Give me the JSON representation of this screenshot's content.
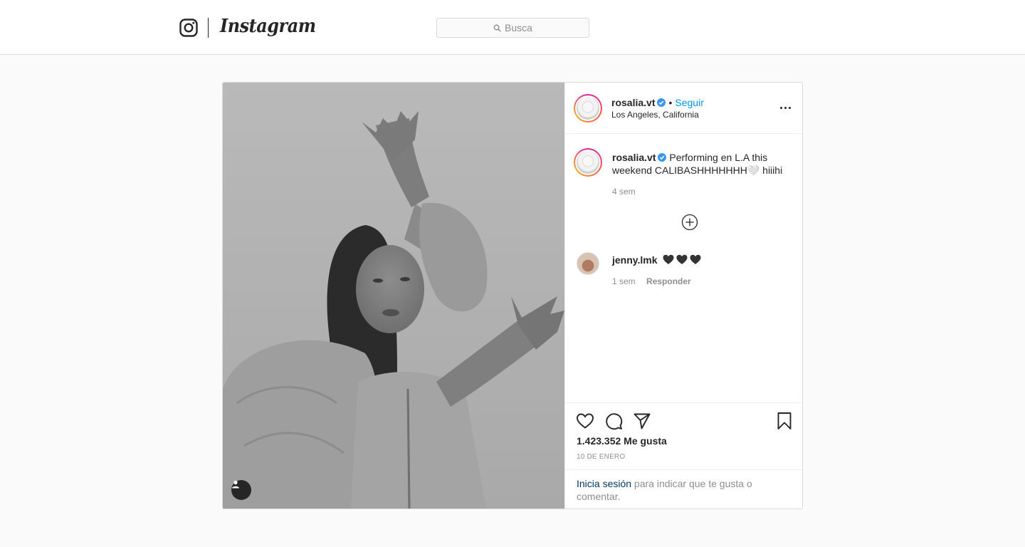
{
  "header": {
    "logo_text": "Instagram",
    "search_placeholder": "Busca"
  },
  "post": {
    "author": {
      "username": "rosalia.vt",
      "verified": true,
      "follow_label": "Seguir",
      "location": "Los Angeles, California"
    },
    "caption": {
      "username": "rosalia.vt",
      "text": "Performing en L.A this weekend CALIBASHHHHHHH🤍 hiiihi",
      "time": "4 sem"
    },
    "comments": [
      {
        "username": "jenny.lmk",
        "text": "🖤🖤🖤",
        "time": "1 sem",
        "reply_label": "Responder"
      }
    ],
    "likes": "1.423.352 Me gusta",
    "date": "10 DE ENERO",
    "login": {
      "link_label": "Inicia sesión",
      "rest_text": " para indicar que te gusta o comentar."
    }
  },
  "colors": {
    "link_blue": "#0095f6",
    "login_link": "#00376b",
    "muted": "#8e8e8e",
    "border": "#dbdbdb"
  },
  "icons": [
    "instagram-camera-icon",
    "search-icon",
    "verified-badge-icon",
    "more-options-icon",
    "load-more-comments-icon",
    "heart-icon",
    "comment-icon",
    "share-icon",
    "bookmark-icon",
    "user-tag-icon"
  ]
}
